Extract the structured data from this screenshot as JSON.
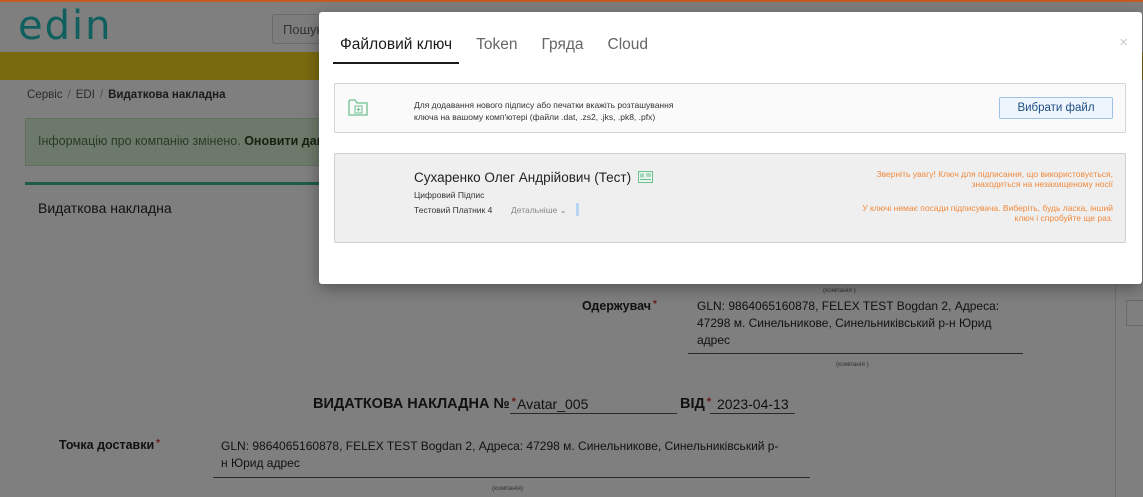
{
  "app": {
    "logo": "edin",
    "search_placeholder": "Пошук"
  },
  "breadcrumb": {
    "items": [
      "Сервіс",
      "EDI"
    ],
    "current": "Видаткова накладна",
    "separator": "/"
  },
  "alert": {
    "text": "Інформацію про компанію змінено. ",
    "link": "Оновити дані п"
  },
  "card": {
    "title": "Видаткова накладна"
  },
  "form": {
    "company_caption": "(компанія )",
    "receiver": {
      "label": "Одержувач",
      "required": "*",
      "value": "GLN: 9864065160878, FELEX TEST Bogdan 2, Адреса: 47298 м. Синельникове, Синельниківський р-н Юрид адрес",
      "caption": "(компанія )"
    },
    "document": {
      "title": "ВИДАТКОВА НАКЛАДНА №",
      "required": "*",
      "number": "Avatar_005",
      "from_label": "ВІД",
      "date": "2023-04-13"
    },
    "delivery": {
      "label": "Точка доставки",
      "required": "*",
      "value": "GLN: 9864065160878, FELEX TEST Bogdan 2, Адреса: 47298 м. Синельникове, Синельниківський р-н Юрид адрес",
      "caption": "(компанія)"
    }
  },
  "modal": {
    "close": "×",
    "tabs": [
      {
        "label": "Файловий ключ",
        "active": true
      },
      {
        "label": "Token",
        "active": false
      },
      {
        "label": "Гряда",
        "active": false
      },
      {
        "label": "Cloud",
        "active": false
      }
    ],
    "file_panel": {
      "hint_line1": "Для додавання нового підпису або печатки вкажіть розташування",
      "hint_line2": "ключа на вашому комп'ютері (файли .dat, .zs2, .jks, .pk8, .pfx)",
      "button": "Вибрати файл"
    },
    "key_panel": {
      "owner": "Сухаренко Олег Андрійович (Тест)",
      "signature_type": "Цифровий Підпис",
      "company": "Тестовий Платник 4",
      "details": "Детальніше",
      "warning1": "Зверніть увагу! Ключ для підписання, що використовується, знаходиться на незахищеному носії",
      "warning2": "У ключі немає посади підписувача. Виберіть, будь ласка, інший ключ і спробуйте ще раз."
    }
  },
  "colors": {
    "accent_text": "#1f4f85",
    "warning": "#f08a3d",
    "brand": "#0f5f5e"
  }
}
